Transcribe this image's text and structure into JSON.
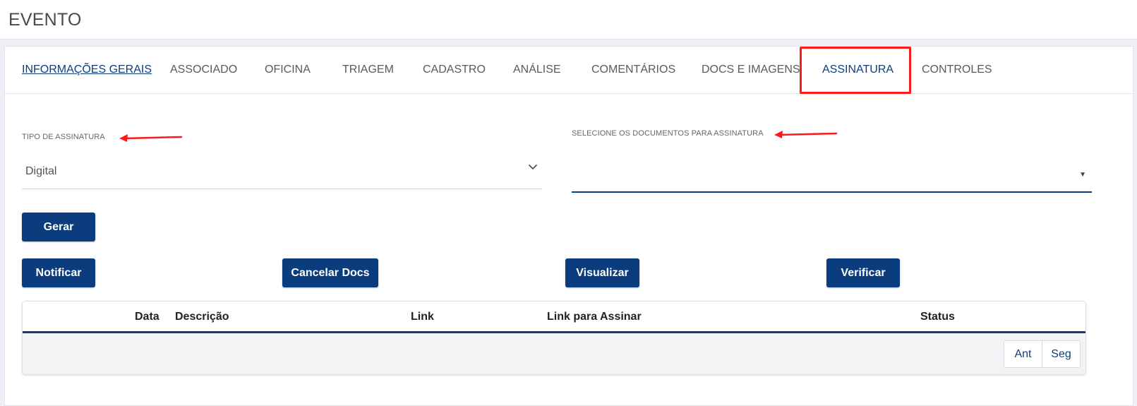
{
  "header": {
    "title": "EVENTO"
  },
  "tabs": [
    {
      "label": "INFORMAÇÕES GERAIS",
      "state": "active"
    },
    {
      "label": "ASSOCIADO"
    },
    {
      "label": "OFICINA"
    },
    {
      "label": "TRIAGEM"
    },
    {
      "label": "CADASTRO"
    },
    {
      "label": "ANÁLISE"
    },
    {
      "label": "COMENTÁRIOS"
    },
    {
      "label": "DOCS E IMAGENS"
    },
    {
      "label": "ASSINATURA",
      "state": "highlighted"
    },
    {
      "label": "CONTROLES"
    }
  ],
  "form": {
    "tipo_assinatura": {
      "label": "TIPO DE ASSINATURA",
      "value": "Digital"
    },
    "documentos": {
      "label": "SELECIONE OS DOCUMENTOS PARA ASSINATURA",
      "value": ""
    }
  },
  "buttons": {
    "gerar": "Gerar",
    "notificar": "Notificar",
    "cancelar_docs": "Cancelar Docs",
    "visualizar": "Visualizar",
    "verificar": "Verificar"
  },
  "table": {
    "columns": [
      "Data",
      "Descrição",
      "Link",
      "Link para Assinar",
      "Status"
    ],
    "rows": [],
    "pager": {
      "prev": "Ant",
      "next": "Seg"
    }
  },
  "colors": {
    "primary": "#0b3d7e",
    "annotation": "#ff1a1a",
    "background": "#eef0f6"
  },
  "icons": {
    "select_chevron": "chevron-down-icon",
    "select_caret": "caret-down-icon",
    "annotation_arrow": "arrow-left-icon"
  }
}
